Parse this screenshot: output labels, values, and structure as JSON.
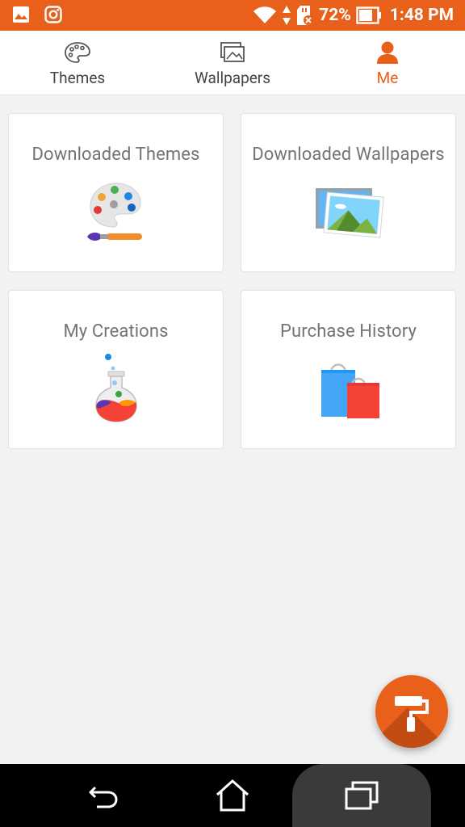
{
  "status_bar": {
    "battery_percent": "72%",
    "time": "1:48 PM",
    "icons": [
      "gallery-icon",
      "instagram-icon",
      "wifi-icon",
      "data-arrows-icon",
      "sd-card-icon",
      "battery-icon"
    ]
  },
  "tabs": [
    {
      "label": "Themes",
      "icon": "palette-icon",
      "active": false
    },
    {
      "label": "Wallpapers",
      "icon": "wallpapers-icon",
      "active": false
    },
    {
      "label": "Me",
      "icon": "person-icon",
      "active": true
    }
  ],
  "cards": [
    {
      "title": "Downloaded Themes",
      "icon": "palette-brush-icon"
    },
    {
      "title": "Downloaded Wallpapers",
      "icon": "landscape-pictures-icon"
    },
    {
      "title": "My Creations",
      "icon": "potion-flask-icon"
    },
    {
      "title": "Purchase History",
      "icon": "shopping-bags-icon"
    }
  ],
  "fab": {
    "icon": "paint-roller-icon"
  },
  "nav_bar": {
    "icons": [
      "back-icon",
      "home-icon",
      "recents-icon"
    ]
  },
  "colors": {
    "accent": "#e8601a",
    "background": "#f2f2f2",
    "card": "#ffffff",
    "card_text": "#747474"
  }
}
